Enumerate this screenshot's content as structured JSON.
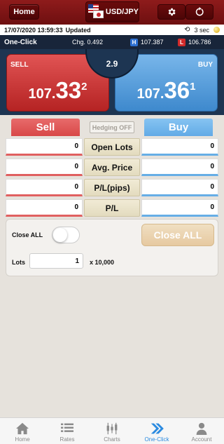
{
  "header": {
    "home_label": "Home",
    "pair_label": "USD/JPY",
    "gear_icon": "gear-icon",
    "refresh_icon": "refresh-icon"
  },
  "status": {
    "timestamp": "17/07/2020 13:59:33",
    "updated": "Updated",
    "interval": "3 sec"
  },
  "oneclick": {
    "title": "One-Click",
    "change": "Chg. 0.492",
    "high_badge": "H",
    "high": "107.387",
    "low_badge": "L",
    "low": "106.786"
  },
  "quote": {
    "sell_label": "SELL",
    "buy_label": "BUY",
    "spread": "2.9",
    "sell": {
      "prefix": "107.",
      "big": "33",
      "pip": "2"
    },
    "buy": {
      "prefix": "107.",
      "big": "36",
      "pip": "1"
    }
  },
  "positions": {
    "sell_header": "Sell",
    "buy_header": "Buy",
    "hedging": "Hedging OFF",
    "rows": [
      {
        "label": "Open  Lots",
        "sell": "0",
        "buy": "0"
      },
      {
        "label": "Avg. Price",
        "sell": "0",
        "buy": "0"
      },
      {
        "label": "P/L(pips)",
        "sell": "0",
        "buy": "0"
      },
      {
        "label": "P/L",
        "sell": "0",
        "buy": "0"
      }
    ]
  },
  "controls": {
    "close_all_label": "Close ALL",
    "close_all_button": "Close ALL",
    "toggle_on": false,
    "lots_label": "Lots",
    "lots_value": "1",
    "lots_unit": "x 10,000"
  },
  "tabs": [
    {
      "label": "Home",
      "icon": "home-icon"
    },
    {
      "label": "Rates",
      "icon": "list-icon"
    },
    {
      "label": "Charts",
      "icon": "candlestick-icon"
    },
    {
      "label": "One-Click",
      "icon": "one-click-icon",
      "active": true
    },
    {
      "label": "Account",
      "icon": "account-icon"
    }
  ],
  "colors": {
    "header": "#7d1416",
    "sell": "#d84848",
    "buy": "#62aae6",
    "active_tab": "#2c8be0"
  }
}
